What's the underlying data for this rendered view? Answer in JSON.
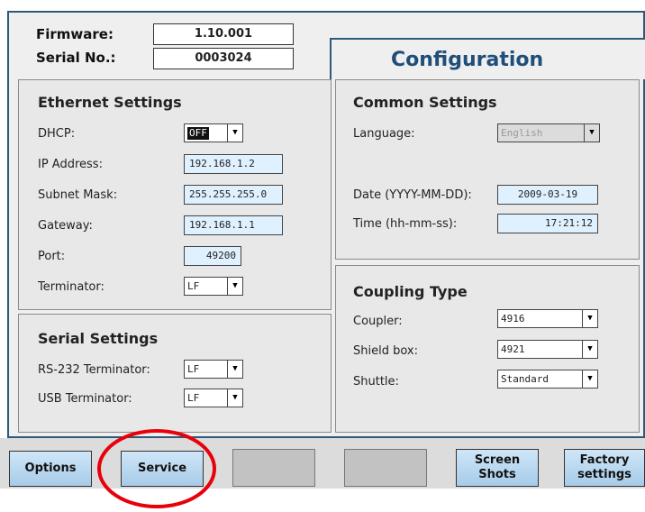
{
  "header": {
    "firmware_label": "Firmware:",
    "firmware_value": "1.10.001",
    "serial_label": "Serial No.:",
    "serial_value": "0003024",
    "title": "Configuration"
  },
  "ethernet": {
    "title": "Ethernet Settings",
    "dhcp_label": "DHCP:",
    "dhcp_value": "OFF",
    "ip_label": "IP Address:",
    "ip_value": "192.168.1.2",
    "subnet_label": "Subnet Mask:",
    "subnet_value": "255.255.255.0",
    "gateway_label": "Gateway:",
    "gateway_value": "192.168.1.1",
    "port_label": "Port:",
    "port_value": "49200",
    "terminator_label": "Terminator:",
    "terminator_value": "LF"
  },
  "serial": {
    "title": "Serial Settings",
    "rs232_label": "RS-232 Terminator:",
    "rs232_value": "LF",
    "usb_label": "USB Terminator:",
    "usb_value": "LF"
  },
  "common": {
    "title": "Common Settings",
    "language_label": "Language:",
    "language_value": "English",
    "date_label": "Date (YYYY-MM-DD):",
    "date_value": "2009-03-19",
    "time_label": "Time (hh-mm-ss):",
    "time_value": "17:21:12"
  },
  "coupling": {
    "title": "Coupling Type",
    "coupler_label": "Coupler:",
    "coupler_value": "4916",
    "shield_label": "Shield box:",
    "shield_value": "4921",
    "shuttle_label": "Shuttle:",
    "shuttle_value": "Standard"
  },
  "buttons": {
    "options": "Options",
    "service": "Service",
    "screen_shots_1": "Screen",
    "screen_shots_2": "Shots",
    "factory_1": "Factory",
    "factory_2": "settings"
  },
  "colors": {
    "accent": "#1f4e79",
    "field_bg": "#dff0ff",
    "button_bg": "#b9d8ef",
    "highlight_circle": "#e8000b"
  },
  "icons": {
    "dropdown": "triangle-down-icon",
    "annotation": "red-circle-highlight"
  }
}
